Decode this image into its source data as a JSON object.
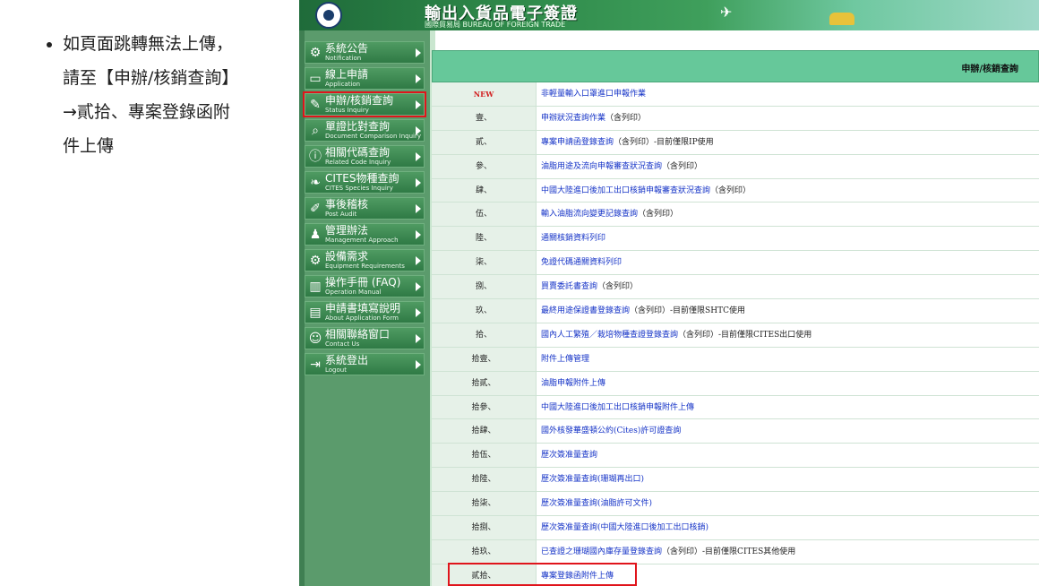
{
  "note": {
    "lines": [
      "如頁面跳轉無法上傳，",
      "請至【申辦/核銷查詢】",
      "→貳拾、專案登錄函附",
      "件上傳"
    ]
  },
  "header": {
    "title": "輸出入貨品電子簽證",
    "subtitle": "國際貿易局 BUREAU OF FOREIGN TRADE"
  },
  "menu": [
    {
      "zh": "系統公告",
      "en": "Notification",
      "icon": "gear-icon"
    },
    {
      "zh": "線上申請",
      "en": "Application",
      "icon": "monitor-icon"
    },
    {
      "zh": "申辦/核銷查詢",
      "en": "Status Inquiry",
      "icon": "edit-icon"
    },
    {
      "zh": "單證比對查詢",
      "en": "Document Comparison Inquiry",
      "icon": "search-icon"
    },
    {
      "zh": "相關代碼查詢",
      "en": "Related Code Inquiry",
      "icon": "info-icon"
    },
    {
      "zh": "CITES物種查詢",
      "en": "CITES Species Inquiry",
      "icon": "leaf-icon"
    },
    {
      "zh": "事後稽核",
      "en": "Post Audit",
      "icon": "pencil-icon"
    },
    {
      "zh": "管理辦法",
      "en": "Management Approach",
      "icon": "person-icon"
    },
    {
      "zh": "設備需求",
      "en": "Equipment Requirements",
      "icon": "cog-icon"
    },
    {
      "zh": "操作手冊 (FAQ)",
      "en": "Operation Manual",
      "icon": "book-icon"
    },
    {
      "zh": "申請書填寫說明",
      "en": "About Application Form",
      "icon": "form-icon"
    },
    {
      "zh": "相關聯絡窗口",
      "en": "Contact Us",
      "icon": "people-icon"
    },
    {
      "zh": "系統登出",
      "en": "Logout",
      "icon": "logout-icon"
    }
  ],
  "table": {
    "header": "申辦/核銷查詢",
    "rows": [
      {
        "num": "NEW",
        "link": "非輕量輸入口罩進口申報作業",
        "rest": ""
      },
      {
        "num": "壹、",
        "link": "申辦狀況查詢作業",
        "rest": "（含列印）"
      },
      {
        "num": "貳、",
        "link": "專案申請函登錄查詢",
        "rest": "（含列印）-目前僅限IP使用"
      },
      {
        "num": "參、",
        "link": "油脂用途及流向申報審查狀況查詢",
        "rest": "（含列印）"
      },
      {
        "num": "肆、",
        "link": "中國大陸進口後加工出口核銷申報審查狀況查詢",
        "rest": "（含列印）"
      },
      {
        "num": "伍、",
        "link": "輸入油脂流向變更記錄查詢",
        "rest": "（含列印）"
      },
      {
        "num": "陸、",
        "link": "通關核銷資料列印",
        "rest": ""
      },
      {
        "num": "柒、",
        "link": "免證代碼通關資料列印",
        "rest": ""
      },
      {
        "num": "捌、",
        "link": "買賣委託書查詢",
        "rest": "（含列印）"
      },
      {
        "num": "玖、",
        "link": "最終用途保證書登錄查詢",
        "rest": "（含列印）-目前僅限SHTC使用"
      },
      {
        "num": "拾、",
        "link": "國內人工繁殖／栽培物種查證登錄查詢",
        "rest": "（含列印）-目前僅限CITES出口使用"
      },
      {
        "num": "拾壹、",
        "link": "附件上傳管理",
        "rest": ""
      },
      {
        "num": "拾貳、",
        "link": "油脂申報附件上傳",
        "rest": ""
      },
      {
        "num": "拾參、",
        "link": "中國大陸進口後加工出口核銷申報附件上傳",
        "rest": ""
      },
      {
        "num": "拾肆、",
        "link": "國外核發華盛頓公約(Cites)許可證查詢",
        "rest": ""
      },
      {
        "num": "拾伍、",
        "link": "歷次簽准量查詢",
        "rest": ""
      },
      {
        "num": "拾陸、",
        "link": "歷次簽准量查詢(珊瑚再出口)",
        "rest": ""
      },
      {
        "num": "拾柒、",
        "link": "歷次簽准量查詢(油脂許可文件)",
        "rest": ""
      },
      {
        "num": "拾捌、",
        "link": "歷次簽准量查詢(中國大陸進口後加工出口核銷)",
        "rest": ""
      },
      {
        "num": "拾玖、",
        "link": "已查證之珊瑚國內庫存量登錄查詢",
        "rest": "（含列印）-目前僅限CITES其他使用"
      },
      {
        "num": "貳拾、",
        "link": "專案登錄函附件上傳",
        "rest": ""
      }
    ]
  }
}
